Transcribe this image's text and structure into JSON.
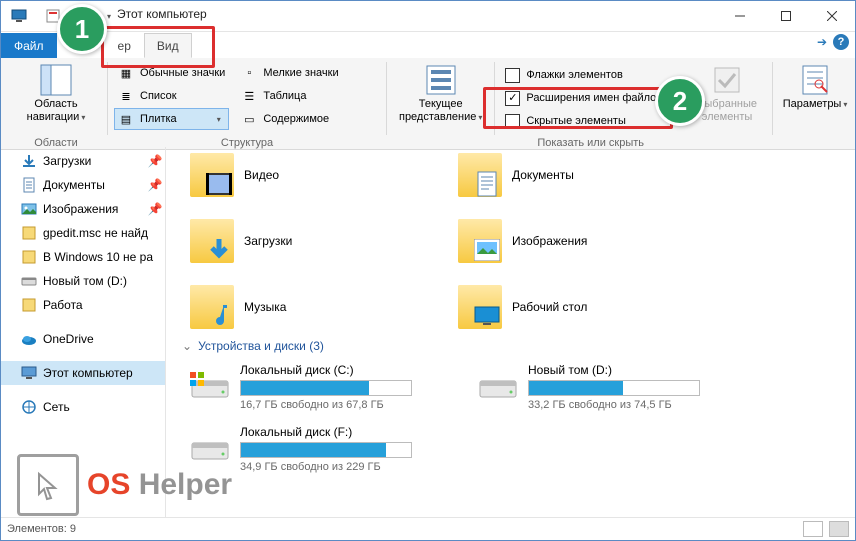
{
  "title": "Этот компьютер",
  "tabs": {
    "file": "Файл",
    "computer_suffix": "ер",
    "view": "Вид"
  },
  "ribbon": {
    "nav_area": "Область\nнавигации",
    "group_areas": "Области",
    "layout": {
      "regular_icons": "Обычные значки",
      "small_icons": "Мелкие значки",
      "list": "Список",
      "table": "Таблица",
      "tiles": "Плитка",
      "content": "Содержимое"
    },
    "group_layout": "Структура",
    "current_view": "Текущее\nпредставление",
    "flags": "Флажки элементов",
    "extensions": "Расширения имен файлов",
    "hidden": "Скрытые элементы",
    "show_hide": "Показать или скрыть",
    "selected": "Выбранные\nэлементы",
    "params": "Параметры"
  },
  "badges": {
    "one": "1",
    "two": "2"
  },
  "nav": [
    {
      "k": "downloads",
      "label": "Загрузки",
      "pin": true
    },
    {
      "k": "documents",
      "label": "Документы",
      "pin": true
    },
    {
      "k": "pictures",
      "label": "Изображения",
      "pin": true
    },
    {
      "k": "gpedit",
      "label": "gpedit.msc не найд"
    },
    {
      "k": "w10",
      "label": "В Windows 10 не ра"
    },
    {
      "k": "newvol",
      "label": "Новый том (D:)"
    },
    {
      "k": "work",
      "label": "Работа"
    },
    {
      "k": "onedrive",
      "label": "OneDrive",
      "top_gap": true
    },
    {
      "k": "thispc",
      "label": "Этот компьютер",
      "selected": true,
      "top_gap": true
    },
    {
      "k": "network",
      "label": "Сеть",
      "top_gap": true
    }
  ],
  "folders_left": [
    {
      "k": "videos",
      "label": "Видео",
      "overlay": "film"
    },
    {
      "k": "downloads",
      "label": "Загрузки",
      "overlay": "arrow"
    },
    {
      "k": "music",
      "label": "Музыка",
      "overlay": "note"
    }
  ],
  "folders_right": [
    {
      "k": "documents",
      "label": "Документы",
      "overlay": "doc"
    },
    {
      "k": "pictures",
      "label": "Изображения",
      "overlay": "pic"
    },
    {
      "k": "desktop",
      "label": "Рабочий стол",
      "overlay": "desk"
    }
  ],
  "devices_header": "Устройства и диски (3)",
  "disks": [
    {
      "k": "c",
      "name": "Локальный диск (C:)",
      "free": "16,7 ГБ свободно из 67,8 ГБ",
      "fill": 75,
      "win": true
    },
    {
      "k": "d",
      "name": "Новый том (D:)",
      "free": "33,2 ГБ свободно из 74,5 ГБ",
      "fill": 55
    },
    {
      "k": "f",
      "name": "Локальный диск (F:)",
      "free": "34,9 ГБ свободно из 229 ГБ",
      "fill": 85
    }
  ],
  "status": {
    "items": "Элементов: 9"
  },
  "logo": {
    "os": "OS",
    "helper": "Helper"
  }
}
